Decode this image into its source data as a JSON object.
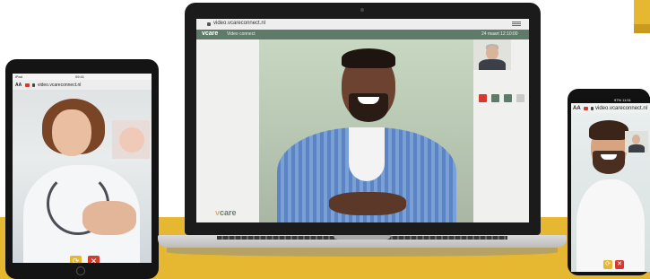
{
  "colors": {
    "accent_yellow": "#e6b832",
    "brand_green": "#5e7a68",
    "end_call_red": "#d63a2f"
  },
  "tablet": {
    "status_time": "09:41",
    "status_left": "iPad",
    "url_prefix": "AA",
    "url": "video.vcareconnect.nl",
    "controls": [
      {
        "icon": "camera-switch-icon"
      },
      {
        "icon": "end-call-icon"
      }
    ]
  },
  "laptop": {
    "browser_url": "video.vcareconnect.nl",
    "app_logo": "vcare",
    "app_header_title": "Video connect",
    "header_date": "24 maart 12:10:00",
    "sidebar_brand_v": "v",
    "sidebar_brand_rest": "care",
    "controls": [
      {
        "icon": "end-call-icon",
        "color": "#d63a2f"
      },
      {
        "icon": "camera-icon",
        "color": "#5e7a68"
      },
      {
        "icon": "microphone-icon",
        "color": "#5e7a68"
      },
      {
        "icon": "settings-icon",
        "color": "#c9cbc6"
      }
    ]
  },
  "phone": {
    "status": "97% 11:51",
    "url_prefix": "AA",
    "url": "video.vcareconnect.nl",
    "controls": [
      {
        "icon": "camera-switch-icon"
      },
      {
        "icon": "end-call-icon"
      }
    ]
  }
}
